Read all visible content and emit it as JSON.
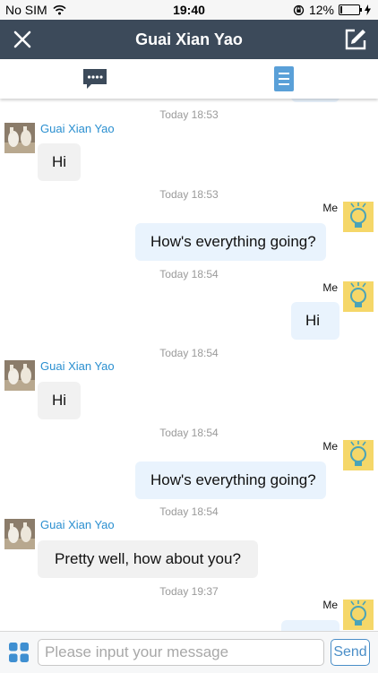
{
  "status_bar": {
    "carrier": "No SIM",
    "time": "19:40",
    "battery": "12%",
    "battery_level": 0.12
  },
  "header": {
    "title": "Guai Xian Yao"
  },
  "tabs": [
    {
      "name": "chat"
    },
    {
      "name": "details"
    }
  ],
  "messages": [
    {
      "timestamp": "Today 18:53",
      "sender": "Guai Xian Yao",
      "text": "Hi"
    },
    {
      "timestamp": "Today 18:53",
      "sender": "Me",
      "text": "How's everything going?"
    },
    {
      "timestamp": "Today 18:54",
      "sender": "Me",
      "text": "Hi"
    },
    {
      "timestamp": "Today 18:54",
      "sender": "Guai Xian Yao",
      "text": "Hi"
    },
    {
      "timestamp": "Today 18:54",
      "sender": "Me",
      "text": "How's everything going?"
    },
    {
      "timestamp": "Today 18:54",
      "sender": "Guai Xian Yao",
      "text": "Pretty well, how about you?"
    },
    {
      "timestamp": "Today 19:37",
      "sender": "Me",
      "text": ""
    }
  ],
  "input": {
    "placeholder": "Please input your message",
    "value": ""
  },
  "send_label": "Send",
  "colors": {
    "header_bg": "#3c4a5a",
    "accent": "#4a8ec8",
    "other_name": "#2a8fd0",
    "in_bubble": "#f1f1f1",
    "out_bubble": "#e9f3fd",
    "avatar_me_bg": "#f5d769"
  }
}
